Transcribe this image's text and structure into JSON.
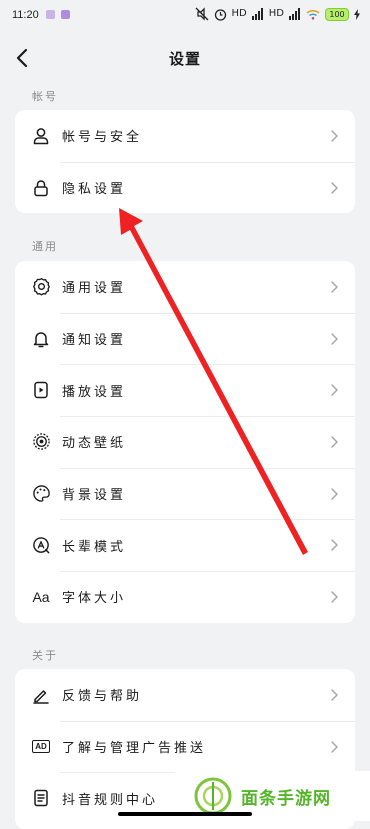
{
  "status_bar": {
    "time": "11:20",
    "signal1": "HD",
    "signal2": "HD",
    "battery": "100"
  },
  "header": {
    "title": "设置"
  },
  "sections": [
    {
      "title": "帐号",
      "items": [
        {
          "label": "帐号与安全",
          "icon": "person-icon"
        },
        {
          "label": "隐私设置",
          "icon": "lock-icon"
        }
      ]
    },
    {
      "title": "通用",
      "items": [
        {
          "label": "通用设置",
          "icon": "gear-icon"
        },
        {
          "label": "通知设置",
          "icon": "bell-icon"
        },
        {
          "label": "播放设置",
          "icon": "play-settings-icon"
        },
        {
          "label": "动态壁纸",
          "icon": "live-wallpaper-icon"
        },
        {
          "label": "背景设置",
          "icon": "palette-icon"
        },
        {
          "label": "长辈模式",
          "icon": "elder-mode-icon"
        },
        {
          "label": "字体大小",
          "icon": "font-size-icon",
          "glyph": "Aa"
        }
      ]
    },
    {
      "title": "关于",
      "items": [
        {
          "label": "反馈与帮助",
          "icon": "pen-icon"
        },
        {
          "label": "了解与管理广告推送",
          "icon": "ad-icon",
          "glyph": "AD"
        },
        {
          "label": "抖音规则中心",
          "icon": "rules-icon"
        }
      ]
    }
  ],
  "watermark": {
    "text": "面条手游网"
  },
  "colors": {
    "background": "#f1f2f4",
    "card": "#ffffff",
    "arrow": "#ee2222",
    "watermark": "#55b52a"
  }
}
